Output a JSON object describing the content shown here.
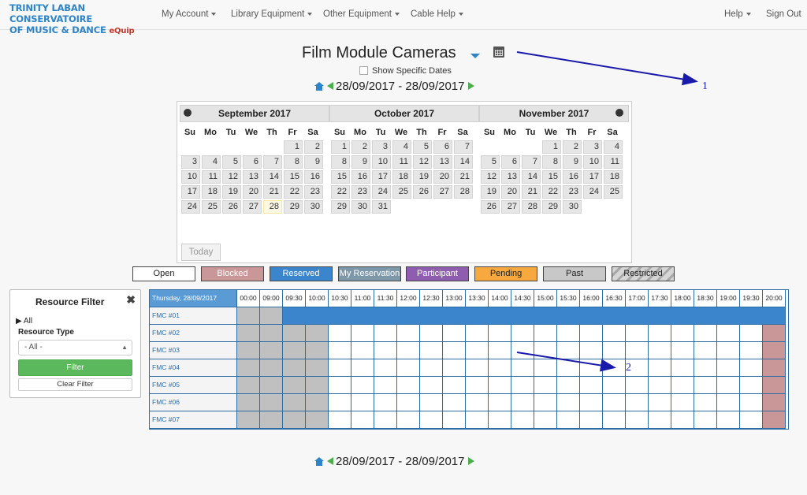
{
  "navbar": {
    "logo_line1": "TRINITY LABAN CONSERVATOIRE",
    "logo_line2": "OF MUSIC & DANCE",
    "logo_equip": "eQuip",
    "menu": [
      "My Account",
      "Library Equipment",
      "Other Equipment",
      "Cable Help"
    ],
    "help": "Help",
    "signout": "Sign Out"
  },
  "header": {
    "title": "Film Module Cameras",
    "show_specific_dates": "Show Specific Dates",
    "date_range": "28/09/2017 - 28/09/2017"
  },
  "calendar": {
    "days_of_week": [
      "Su",
      "Mo",
      "Tu",
      "We",
      "Th",
      "Fr",
      "Sa"
    ],
    "today_label": "Today",
    "highlight_day": "28",
    "months": [
      {
        "name": "September 2017",
        "first_weekday": 5,
        "days": 30
      },
      {
        "name": "October 2017",
        "first_weekday": 0,
        "days": 31
      },
      {
        "name": "November 2017",
        "first_weekday": 3,
        "days": 30
      }
    ]
  },
  "legend": [
    {
      "label": "Open",
      "color": "#ffffff"
    },
    {
      "label": "Blocked",
      "color": "#c99797"
    },
    {
      "label": "Reserved",
      "color": "#3a85cc"
    },
    {
      "label": "My Reservation",
      "color": "#7c97a8"
    },
    {
      "label": "Participant",
      "color": "#8e5db0"
    },
    {
      "label": "Pending",
      "color": "#f7a83f"
    },
    {
      "label": "Past",
      "color": "#c8c8c8"
    },
    {
      "label": "Restricted",
      "color": "#bdbdbd"
    }
  ],
  "filter": {
    "title": "Resource Filter",
    "all_label": "All",
    "resource_type_label": "Resource Type",
    "select_value": "- All -",
    "filter_button": "Filter",
    "clear_button": "Clear Filter"
  },
  "schedule": {
    "date_header": "Thursday, 28/09/2017",
    "times": [
      "00:00",
      "09:00",
      "09:30",
      "10:00",
      "10:30",
      "11:00",
      "11:30",
      "12:00",
      "12:30",
      "13:00",
      "13:30",
      "14:00",
      "14:30",
      "15:00",
      "15:30",
      "16:00",
      "16:30",
      "17:00",
      "17:30",
      "18:00",
      "18:30",
      "19:00",
      "19:30",
      "20:00"
    ],
    "resources": [
      "FMC #01",
      "FMC #02",
      "FMC #03",
      "FMC #04",
      "FMC #05",
      "FMC #06",
      "FMC #07"
    ],
    "past_columns": 4,
    "reserved_row": 0,
    "reserved_from_column": 2,
    "blocked_last_column": true,
    "colors": {
      "header_blue": "#5b9bd5",
      "past": "#c0c0c0",
      "reserved": "#3a85cc",
      "blocked": "#c99797"
    }
  },
  "annotations": [
    "1",
    "2"
  ]
}
